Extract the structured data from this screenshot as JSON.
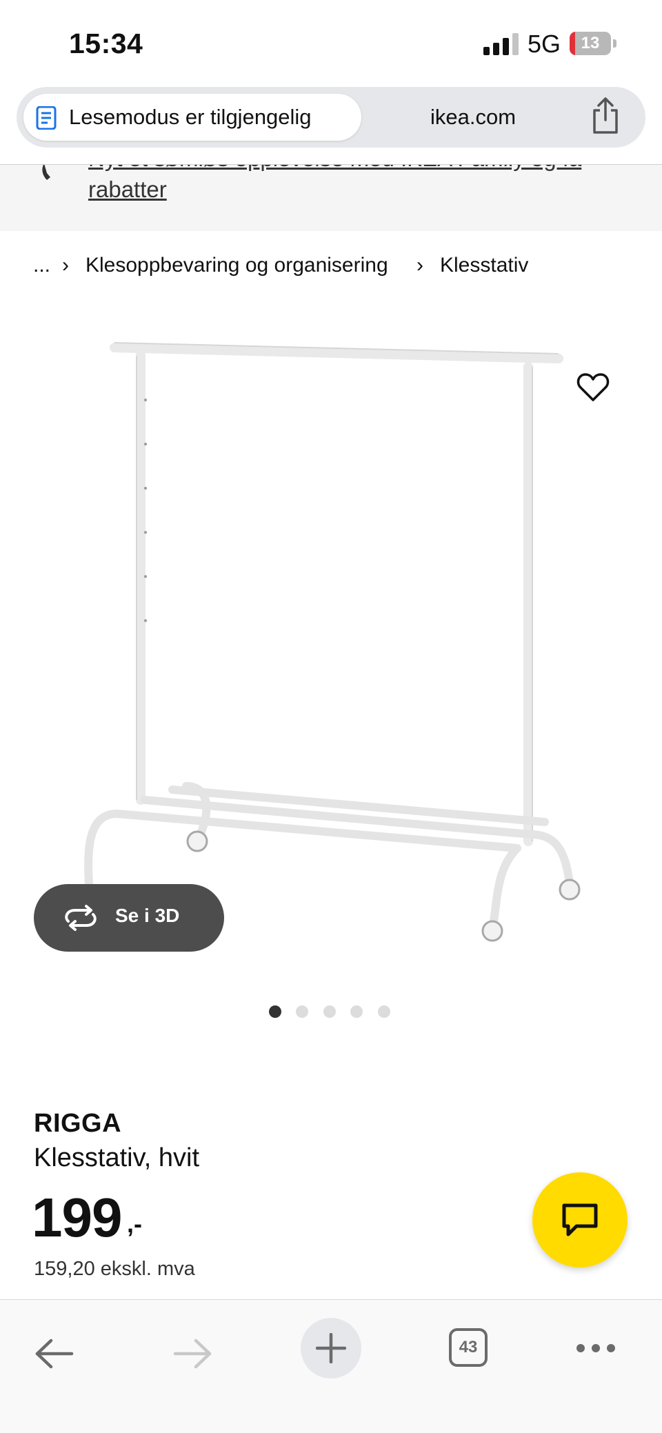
{
  "status_bar": {
    "time": "15:34",
    "network": "5G",
    "battery_level": "13",
    "battery_fraction": 0.13,
    "battery_color": "#e0313a"
  },
  "url_bar": {
    "reader_mode_label": "Lesemodus er tilgjengelig",
    "domain": "ikea.com",
    "reader_icon": "document-icon",
    "share_icon": "share-icon"
  },
  "banner": {
    "text_line1": "Nyt et sømløs opplevelse med IKEA Family og få",
    "text_line2": "rabatter"
  },
  "breadcrumb": {
    "ellipsis": "...",
    "items": [
      "Klesoppbevaring og organisering",
      "Klesstativ"
    ],
    "separator": "›"
  },
  "gallery": {
    "view_3d_label": "Se i 3D",
    "dot_count": 5,
    "active_index": 0,
    "favorite_icon": "heart-icon"
  },
  "product": {
    "name": "RIGGA",
    "description": "Klesstativ, hvit",
    "price": "199",
    "price_suffix": ",-",
    "price_excl_vat": "159,20 ekskl. mva"
  },
  "chat": {
    "icon": "chat-bubble-icon",
    "color": "#ffdb00"
  },
  "toolbar": {
    "tab_count": "43",
    "icons": [
      "back-arrow-icon",
      "forward-arrow-icon",
      "plus-icon",
      "tabs-icon",
      "more-dots-icon"
    ]
  }
}
